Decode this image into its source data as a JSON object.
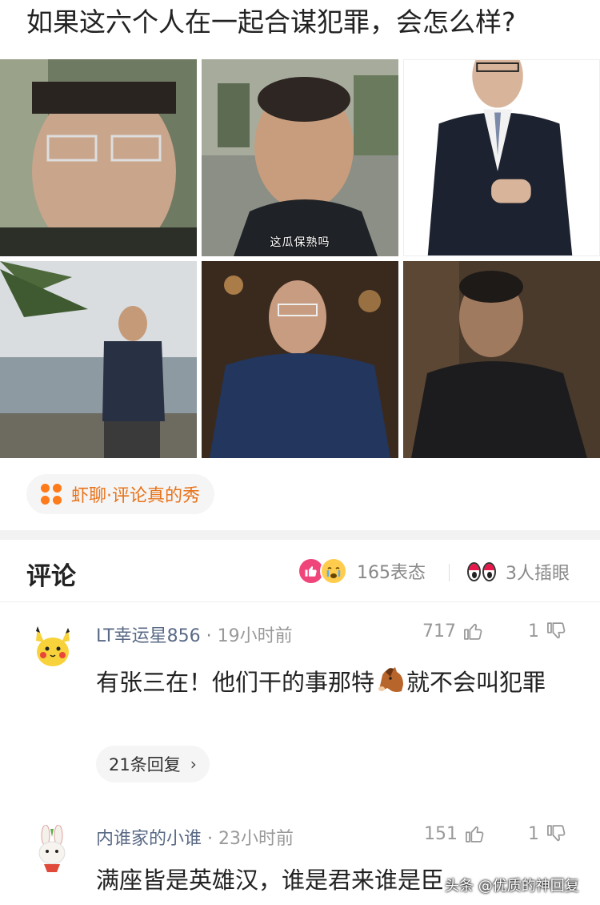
{
  "post": {
    "title": "如果这六个人在一起合谋犯罪，会怎么样?",
    "photo_subtitle": "这瓜保熟吗"
  },
  "topic": {
    "label": "虾聊·评论真的秀"
  },
  "comments_header": {
    "title": "评论",
    "reactions_label": "165表态",
    "watchers_label": "3人插眼"
  },
  "comments": [
    {
      "user": "LT幸运星856",
      "time": "19小时前",
      "likes": "717",
      "dislikes": "1",
      "text_before": "有张三在！他们干的事那特",
      "emoji": "horse-face",
      "text_after": "就不会叫犯罪",
      "replies_label": "21条回复",
      "avatar": "pikachu-avatar"
    },
    {
      "user": "内谁家的小谁",
      "time": "23小时前",
      "likes": "151",
      "dislikes": "1",
      "text": "满座皆是英雄汉，谁是君来谁是臣",
      "avatar": "rabbit-avatar"
    }
  ],
  "watermark": "头条 @优质的神回复",
  "colors": {
    "accent_orange": "#e8731a",
    "like_pink": "#f0457b",
    "username": "#5a6a86"
  }
}
